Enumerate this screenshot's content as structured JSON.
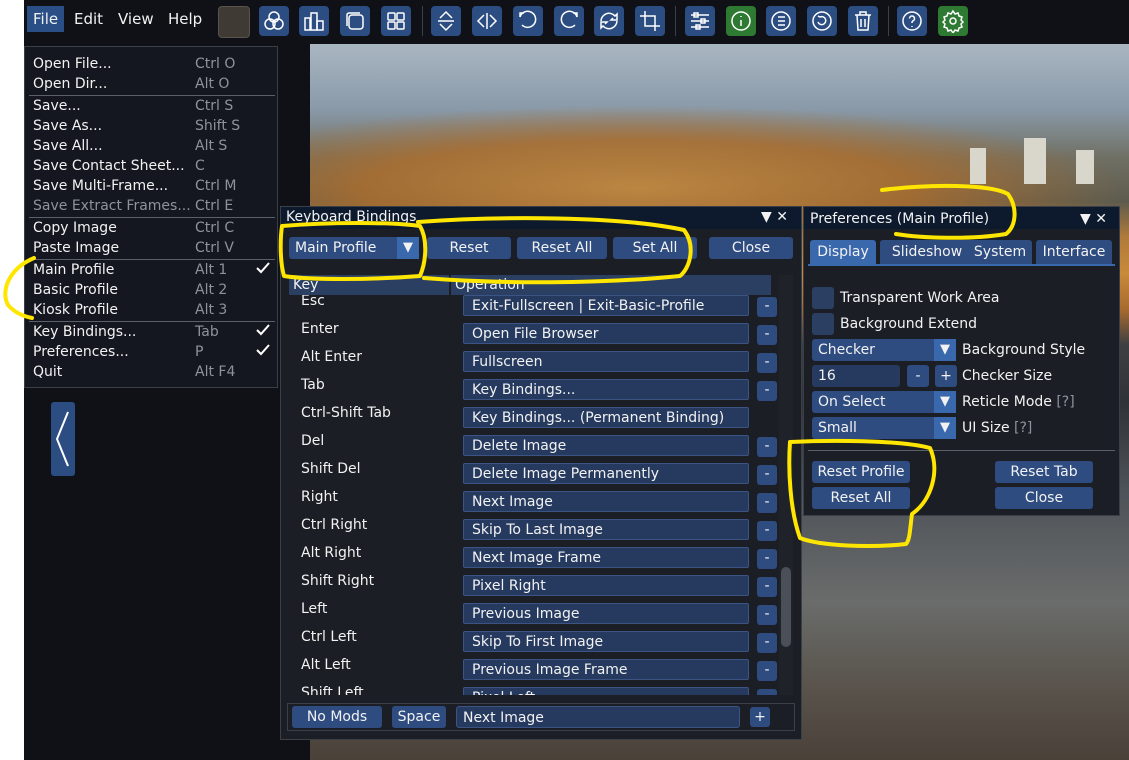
{
  "menubar": {
    "menus": [
      "File",
      "Edit",
      "View",
      "Help"
    ],
    "toolbar_icons": [
      "color-swatch-icon",
      "channels-icon",
      "histogram-icon",
      "window-icon",
      "grid-icon",
      "flip-vertical-icon",
      "flip-horizontal-icon",
      "rotate-left-icon",
      "rotate-right-icon",
      "rotate-both-icon",
      "crop-icon",
      "adjustments-icon",
      "info-icon",
      "list-icon",
      "refresh-icon",
      "trash-icon",
      "help-icon",
      "gear-icon"
    ]
  },
  "file_menu": {
    "items": [
      {
        "label": "Open File...",
        "shortcut": "Ctrl O"
      },
      {
        "label": "Open Dir...",
        "shortcut": "Alt O"
      },
      {
        "label": "Save...",
        "shortcut": "Ctrl S"
      },
      {
        "label": "Save As...",
        "shortcut": "Shift S"
      },
      {
        "label": "Save All...",
        "shortcut": "Alt S"
      },
      {
        "label": "Save Contact Sheet...",
        "shortcut": "C"
      },
      {
        "label": "Save Multi-Frame...",
        "shortcut": "Ctrl M"
      },
      {
        "label": "Save Extract Frames...",
        "shortcut": "Ctrl E"
      },
      {
        "label": "Copy Image",
        "shortcut": "Ctrl C"
      },
      {
        "label": "Paste Image",
        "shortcut": "Ctrl V"
      },
      {
        "label": "Main Profile",
        "shortcut": "Alt 1"
      },
      {
        "label": "Basic Profile",
        "shortcut": "Alt 2"
      },
      {
        "label": "Kiosk Profile",
        "shortcut": "Alt 3"
      },
      {
        "label": "Key Bindings...",
        "shortcut": "Tab"
      },
      {
        "label": "Preferences...",
        "shortcut": "P"
      },
      {
        "label": "Quit",
        "shortcut": "Alt F4"
      }
    ]
  },
  "keybindings": {
    "title": "Keyboard Bindings",
    "window_controls": "▼ ✕",
    "profile_select": "Main Profile",
    "buttons": {
      "reset": "Reset",
      "reset_all": "Reset All",
      "set_all": "Set All",
      "close": "Close"
    },
    "headers": {
      "key": "Key",
      "operation": "Operation"
    },
    "rows": [
      {
        "key": "Esc",
        "op": "Exit-Fullscreen | Exit-Basic-Profile"
      },
      {
        "key": "Enter",
        "op": "Open File Browser"
      },
      {
        "key": "Alt Enter",
        "op": "Fullscreen"
      },
      {
        "key": "Tab",
        "op": "Key Bindings..."
      },
      {
        "key": "Ctrl-Shift Tab",
        "op": "Key Bindings... (Permanent Binding)"
      },
      {
        "key": "Del",
        "op": "Delete Image"
      },
      {
        "key": "Shift Del",
        "op": "Delete Image Permanently"
      },
      {
        "key": "Right",
        "op": "Next Image"
      },
      {
        "key": "Ctrl Right",
        "op": "Skip To Last Image"
      },
      {
        "key": "Alt Right",
        "op": "Next Image Frame"
      },
      {
        "key": "Shift Right",
        "op": "Pixel Right"
      },
      {
        "key": "Left",
        "op": "Previous Image"
      },
      {
        "key": "Ctrl Left",
        "op": "Skip To First Image"
      },
      {
        "key": "Alt Left",
        "op": "Previous Image Frame"
      },
      {
        "key": "Shift Left",
        "op": "Pixel Left"
      }
    ],
    "minus_label": "-",
    "footer": {
      "mods": "No Mods",
      "key": "Space",
      "op": "Next Image",
      "plus": "+"
    }
  },
  "preferences": {
    "title": "Preferences (Main Profile)",
    "window_controls": "▼ ✕",
    "tabs": [
      "Display",
      "Slideshow",
      "System",
      "Interface"
    ],
    "transparent_work_area": "Transparent Work Area",
    "background_extend": "Background Extend",
    "background_style": {
      "value": "Checker",
      "label": "Background Style"
    },
    "checker_size": {
      "value": "16",
      "label": "Checker Size",
      "minus": "-",
      "plus": "+"
    },
    "reticle_mode": {
      "value": "On Select",
      "label": "Reticle Mode",
      "help": "[?]"
    },
    "ui_size": {
      "value": "Small",
      "label": "UI Size",
      "help": "[?]"
    },
    "buttons": {
      "reset_profile": "Reset Profile",
      "reset_tab": "Reset Tab",
      "reset_all": "Reset All",
      "close": "Close"
    }
  },
  "colors": {
    "accent": "#2e4c80",
    "annotation": "#ffe600",
    "background": "#0f1117"
  }
}
